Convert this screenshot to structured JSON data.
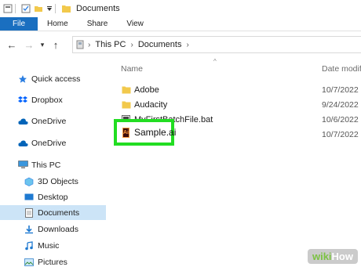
{
  "window": {
    "title": "Documents"
  },
  "ribbon": {
    "tabs": [
      "File",
      "Home",
      "Share",
      "View"
    ]
  },
  "address": {
    "crumbs": [
      "This PC",
      "Documents"
    ]
  },
  "sidebar": {
    "items": [
      {
        "label": "Quick access"
      },
      {
        "label": "Dropbox"
      },
      {
        "label": "OneDrive"
      },
      {
        "label": "OneDrive"
      },
      {
        "label": "This PC"
      },
      {
        "label": "3D Objects"
      },
      {
        "label": "Desktop"
      },
      {
        "label": "Documents"
      },
      {
        "label": "Downloads"
      },
      {
        "label": "Music"
      },
      {
        "label": "Pictures"
      }
    ]
  },
  "content": {
    "columns": {
      "name": "Name",
      "date": "Date modifie"
    },
    "rows": [
      {
        "name": "Adobe",
        "date": "10/7/2022"
      },
      {
        "name": "Audacity",
        "date": "9/24/2022"
      },
      {
        "name": "MyFirstBatchFile.bat",
        "date": "10/6/2022"
      },
      {
        "name": "Sample.ai",
        "date": "10/7/2022"
      }
    ],
    "ai_icon_text": "Ai"
  },
  "watermark": {
    "prefix": "wiki",
    "suffix": "How"
  }
}
